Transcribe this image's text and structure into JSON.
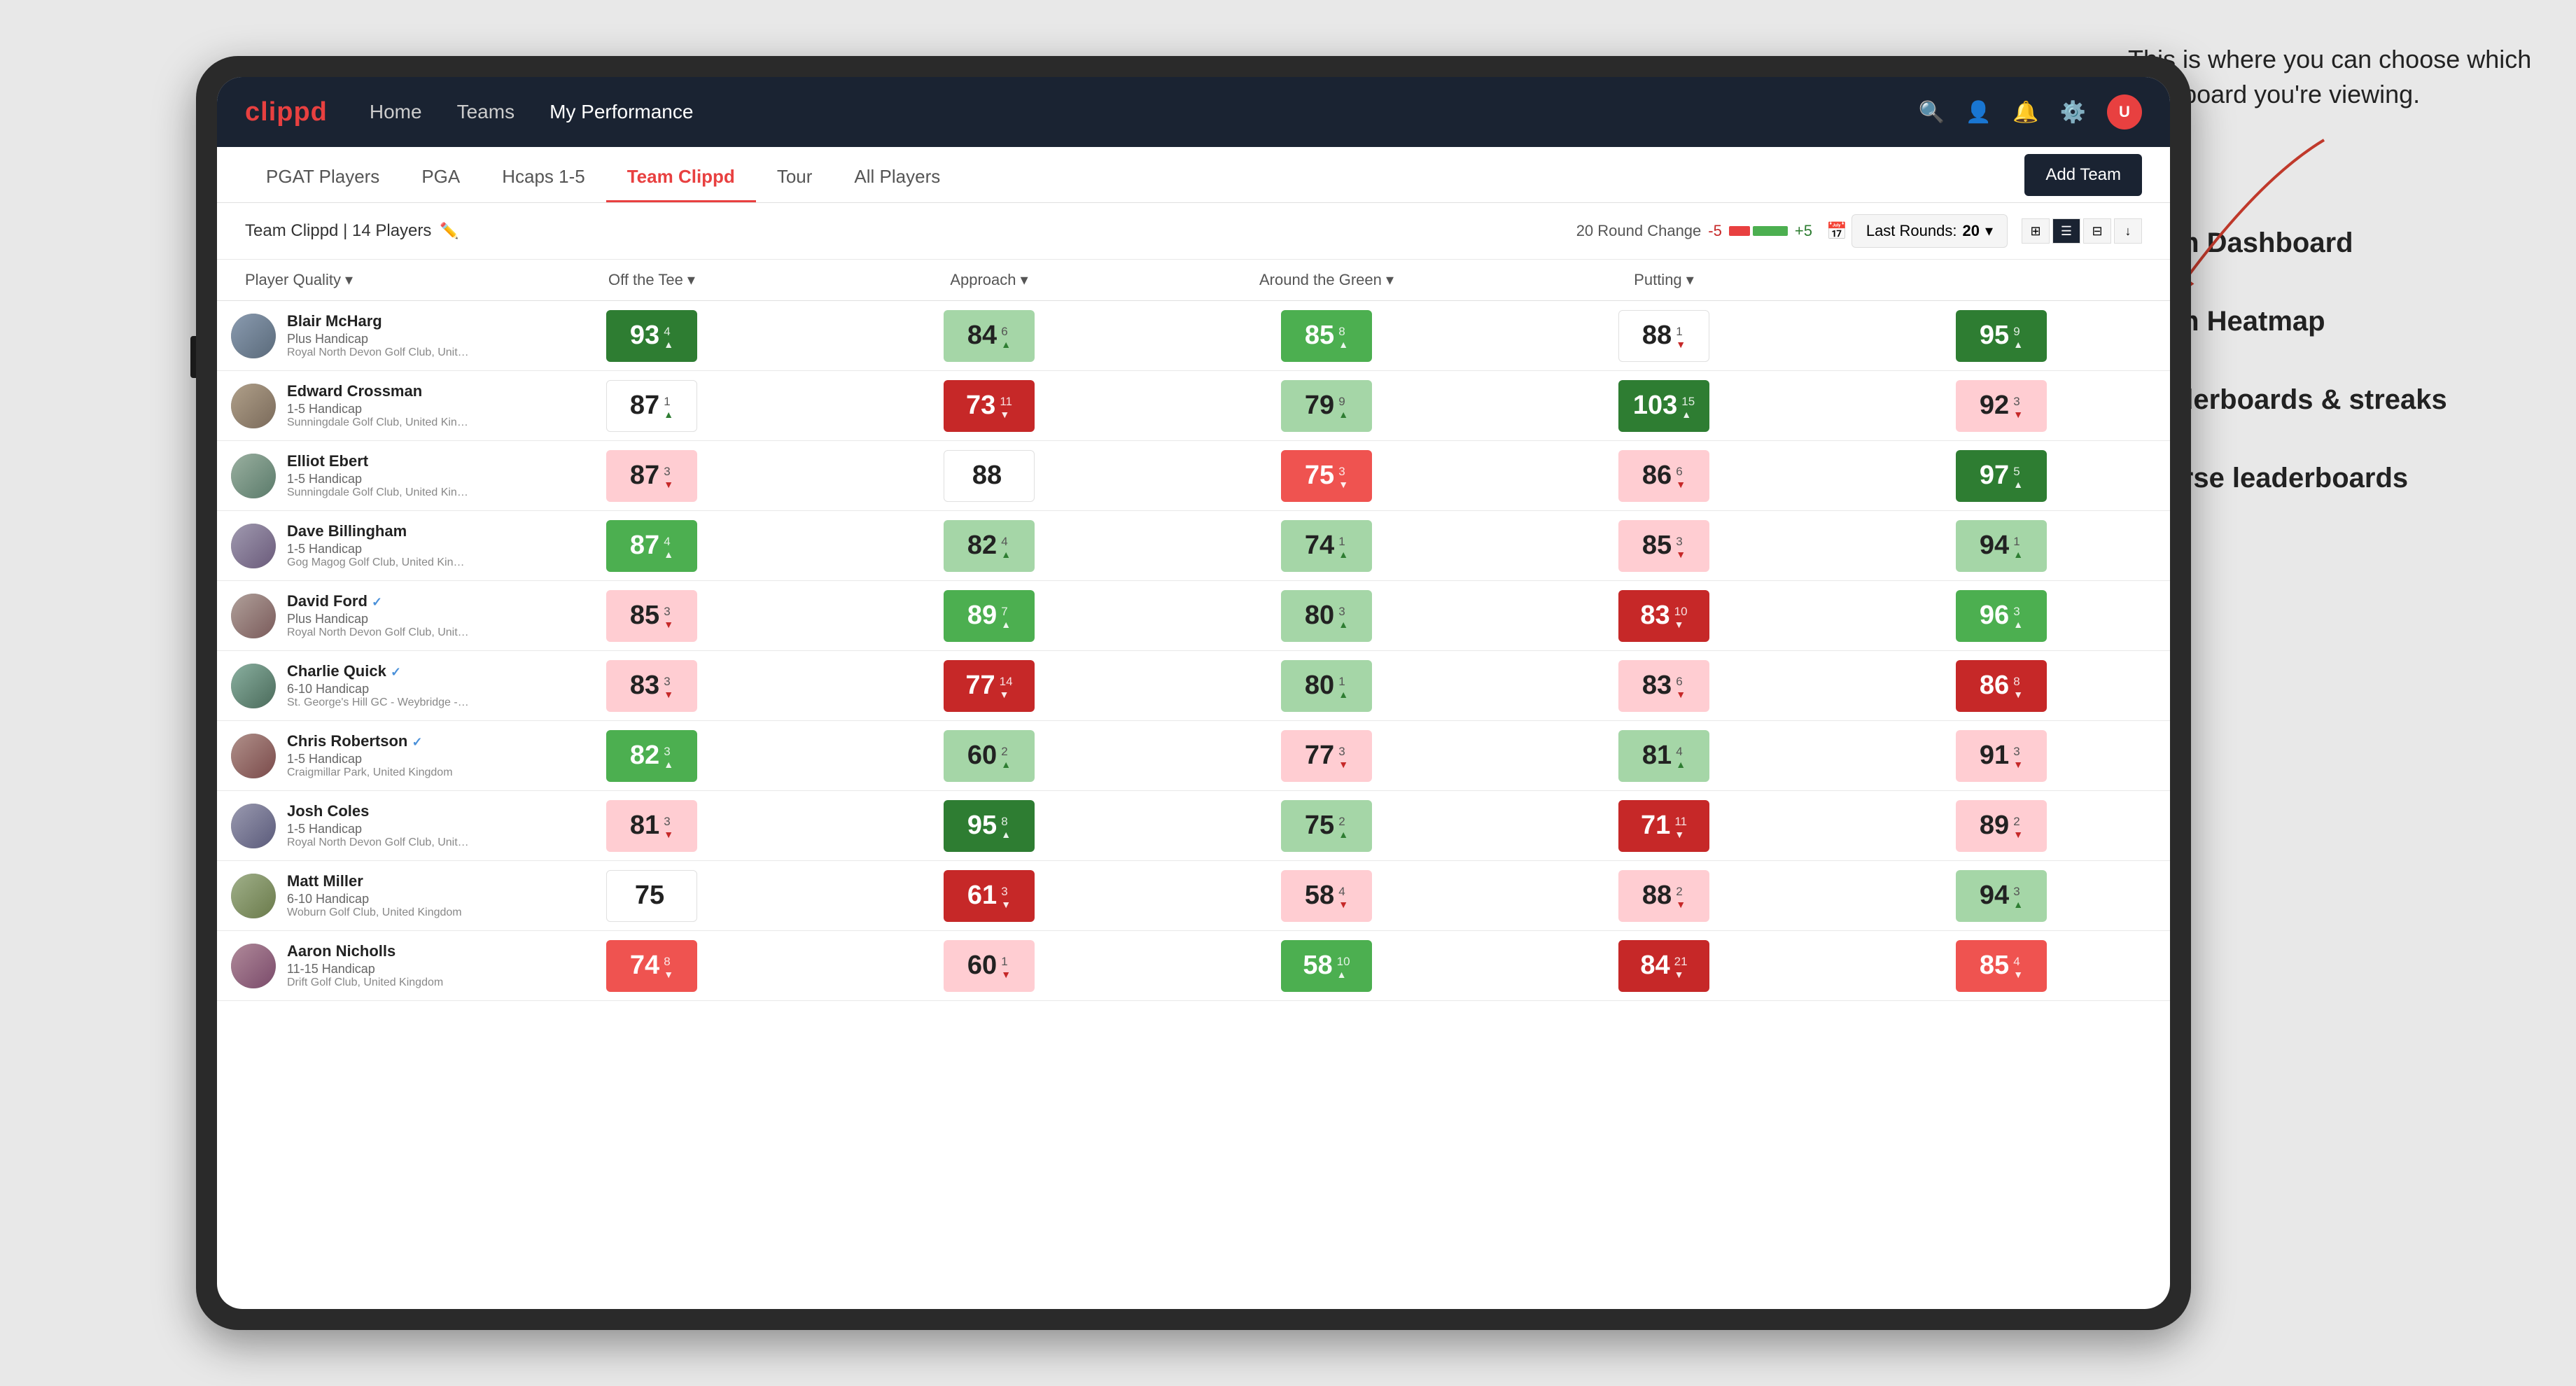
{
  "annotation": {
    "intro": "This is where you can choose which dashboard you're viewing.",
    "menu_items": [
      "Team Dashboard",
      "Team Heatmap",
      "Leaderboards & streaks",
      "Course leaderboards"
    ]
  },
  "navbar": {
    "logo": "clippd",
    "links": [
      "Home",
      "Teams",
      "My Performance"
    ],
    "active_link": "My Performance"
  },
  "tabs": {
    "items": [
      "PGAT Players",
      "PGA",
      "Hcaps 1-5",
      "Team Clippd",
      "Tour",
      "All Players"
    ],
    "active": "Team Clippd",
    "add_team_label": "Add Team"
  },
  "team_header": {
    "name": "Team Clippd",
    "player_count": "14 Players",
    "round_change_label": "20 Round Change",
    "change_minus": "-5",
    "change_plus": "+5",
    "last_rounds_label": "Last Rounds:",
    "last_rounds_value": "20"
  },
  "table": {
    "columns": [
      "Player Quality ▾",
      "Off the Tee ▾",
      "Approach ▾",
      "Around the Green ▾",
      "Putting ▾"
    ],
    "players": [
      {
        "name": "Blair McHarg",
        "handicap": "Plus Handicap",
        "club": "Royal North Devon Golf Club, United Kingdom",
        "verified": false,
        "scores": [
          {
            "value": "93",
            "change": "4",
            "direction": "up",
            "bg": "green-strong"
          },
          {
            "value": "84",
            "change": "6",
            "direction": "up",
            "bg": "green-light"
          },
          {
            "value": "85",
            "change": "8",
            "direction": "up",
            "bg": "green-medium"
          },
          {
            "value": "88",
            "change": "1",
            "direction": "down",
            "bg": "white"
          },
          {
            "value": "95",
            "change": "9",
            "direction": "up",
            "bg": "green-strong"
          }
        ]
      },
      {
        "name": "Edward Crossman",
        "handicap": "1-5 Handicap",
        "club": "Sunningdale Golf Club, United Kingdom",
        "verified": false,
        "scores": [
          {
            "value": "87",
            "change": "1",
            "direction": "up",
            "bg": "white"
          },
          {
            "value": "73",
            "change": "11",
            "direction": "down",
            "bg": "red-strong"
          },
          {
            "value": "79",
            "change": "9",
            "direction": "up",
            "bg": "green-light"
          },
          {
            "value": "103",
            "change": "15",
            "direction": "up",
            "bg": "green-strong"
          },
          {
            "value": "92",
            "change": "3",
            "direction": "down",
            "bg": "red-light"
          }
        ]
      },
      {
        "name": "Elliot Ebert",
        "handicap": "1-5 Handicap",
        "club": "Sunningdale Golf Club, United Kingdom",
        "verified": false,
        "scores": [
          {
            "value": "87",
            "change": "3",
            "direction": "down",
            "bg": "red-light"
          },
          {
            "value": "88",
            "change": "",
            "direction": "none",
            "bg": "white"
          },
          {
            "value": "75",
            "change": "3",
            "direction": "down",
            "bg": "red-medium"
          },
          {
            "value": "86",
            "change": "6",
            "direction": "down",
            "bg": "red-light"
          },
          {
            "value": "97",
            "change": "5",
            "direction": "up",
            "bg": "green-strong"
          }
        ]
      },
      {
        "name": "Dave Billingham",
        "handicap": "1-5 Handicap",
        "club": "Gog Magog Golf Club, United Kingdom",
        "verified": false,
        "scores": [
          {
            "value": "87",
            "change": "4",
            "direction": "up",
            "bg": "green-medium"
          },
          {
            "value": "82",
            "change": "4",
            "direction": "up",
            "bg": "green-light"
          },
          {
            "value": "74",
            "change": "1",
            "direction": "up",
            "bg": "green-light"
          },
          {
            "value": "85",
            "change": "3",
            "direction": "down",
            "bg": "red-light"
          },
          {
            "value": "94",
            "change": "1",
            "direction": "up",
            "bg": "green-light"
          }
        ]
      },
      {
        "name": "David Ford",
        "handicap": "Plus Handicap",
        "club": "Royal North Devon Golf Club, United Kingdom",
        "verified": true,
        "scores": [
          {
            "value": "85",
            "change": "3",
            "direction": "down",
            "bg": "red-light"
          },
          {
            "value": "89",
            "change": "7",
            "direction": "up",
            "bg": "green-medium"
          },
          {
            "value": "80",
            "change": "3",
            "direction": "up",
            "bg": "green-light"
          },
          {
            "value": "83",
            "change": "10",
            "direction": "down",
            "bg": "red-strong"
          },
          {
            "value": "96",
            "change": "3",
            "direction": "up",
            "bg": "green-medium"
          }
        ]
      },
      {
        "name": "Charlie Quick",
        "handicap": "6-10 Handicap",
        "club": "St. George's Hill GC - Weybridge - Surrey, Uni...",
        "verified": true,
        "scores": [
          {
            "value": "83",
            "change": "3",
            "direction": "down",
            "bg": "red-light"
          },
          {
            "value": "77",
            "change": "14",
            "direction": "down",
            "bg": "red-strong"
          },
          {
            "value": "80",
            "change": "1",
            "direction": "up",
            "bg": "green-light"
          },
          {
            "value": "83",
            "change": "6",
            "direction": "down",
            "bg": "red-light"
          },
          {
            "value": "86",
            "change": "8",
            "direction": "down",
            "bg": "red-strong"
          }
        ]
      },
      {
        "name": "Chris Robertson",
        "handicap": "1-5 Handicap",
        "club": "Craigmillar Park, United Kingdom",
        "verified": true,
        "scores": [
          {
            "value": "82",
            "change": "3",
            "direction": "up",
            "bg": "green-medium"
          },
          {
            "value": "60",
            "change": "2",
            "direction": "up",
            "bg": "green-light"
          },
          {
            "value": "77",
            "change": "3",
            "direction": "down",
            "bg": "red-light"
          },
          {
            "value": "81",
            "change": "4",
            "direction": "up",
            "bg": "green-light"
          },
          {
            "value": "91",
            "change": "3",
            "direction": "down",
            "bg": "red-light"
          }
        ]
      },
      {
        "name": "Josh Coles",
        "handicap": "1-5 Handicap",
        "club": "Royal North Devon Golf Club, United Kingdom",
        "verified": false,
        "scores": [
          {
            "value": "81",
            "change": "3",
            "direction": "down",
            "bg": "red-light"
          },
          {
            "value": "95",
            "change": "8",
            "direction": "up",
            "bg": "green-strong"
          },
          {
            "value": "75",
            "change": "2",
            "direction": "up",
            "bg": "green-light"
          },
          {
            "value": "71",
            "change": "11",
            "direction": "down",
            "bg": "red-strong"
          },
          {
            "value": "89",
            "change": "2",
            "direction": "down",
            "bg": "red-light"
          }
        ]
      },
      {
        "name": "Matt Miller",
        "handicap": "6-10 Handicap",
        "club": "Woburn Golf Club, United Kingdom",
        "verified": false,
        "scores": [
          {
            "value": "75",
            "change": "",
            "direction": "none",
            "bg": "white"
          },
          {
            "value": "61",
            "change": "3",
            "direction": "down",
            "bg": "red-strong"
          },
          {
            "value": "58",
            "change": "4",
            "direction": "down",
            "bg": "red-light"
          },
          {
            "value": "88",
            "change": "2",
            "direction": "down",
            "bg": "red-light"
          },
          {
            "value": "94",
            "change": "3",
            "direction": "up",
            "bg": "green-light"
          }
        ]
      },
      {
        "name": "Aaron Nicholls",
        "handicap": "11-15 Handicap",
        "club": "Drift Golf Club, United Kingdom",
        "verified": false,
        "scores": [
          {
            "value": "74",
            "change": "8",
            "direction": "down",
            "bg": "red-medium"
          },
          {
            "value": "60",
            "change": "1",
            "direction": "down",
            "bg": "red-light"
          },
          {
            "value": "58",
            "change": "10",
            "direction": "up",
            "bg": "green-medium"
          },
          {
            "value": "84",
            "change": "21",
            "direction": "down",
            "bg": "red-strong"
          },
          {
            "value": "85",
            "change": "4",
            "direction": "down",
            "bg": "red-medium"
          }
        ]
      }
    ]
  },
  "colors": {
    "green_strong": "#2e7d32",
    "green_medium": "#4caf50",
    "green_light": "#a5d6a7",
    "red_strong": "#c62828",
    "red_medium": "#ef5350",
    "red_light": "#ffcdd2",
    "white": "#ffffff",
    "navy": "#1a2332",
    "accent": "#e84040"
  }
}
